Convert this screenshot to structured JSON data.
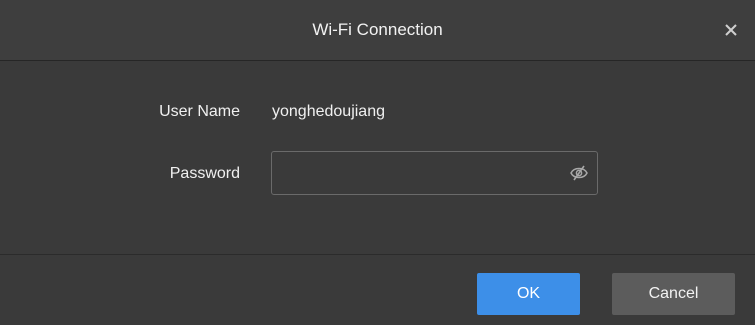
{
  "dialog": {
    "title": "Wi-Fi Connection",
    "close_icon": "close-icon"
  },
  "form": {
    "user_name_label": "User Name",
    "user_name_value": "yonghedoujiang",
    "password_label": "Password",
    "password_value": "",
    "password_placeholder": "",
    "visibility_icon": "eye-hidden-icon"
  },
  "footer": {
    "ok_label": "OK",
    "cancel_label": "Cancel"
  },
  "colors": {
    "background": "#3a3a3a",
    "primary_button": "#3d8fe8",
    "secondary_button": "#5c5c5c",
    "text": "#f0f0f0"
  }
}
